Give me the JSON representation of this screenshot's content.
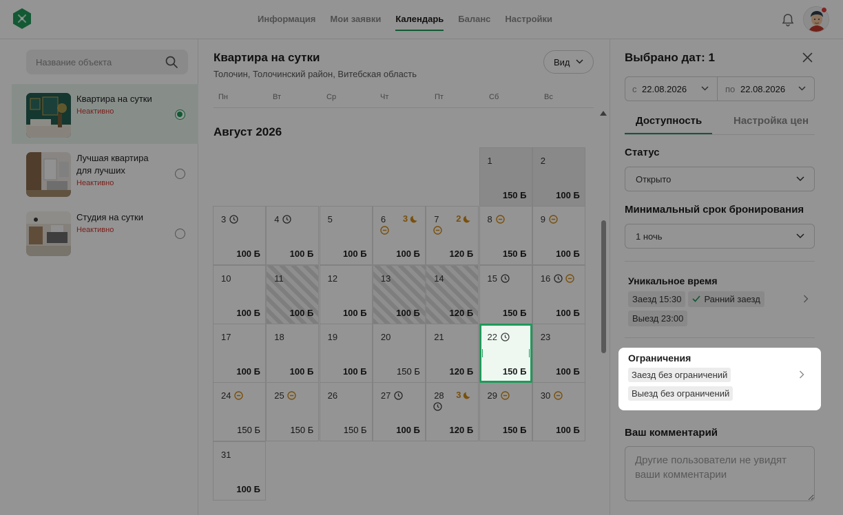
{
  "nav": {
    "items": [
      "Информация",
      "Мои заявки",
      "Календарь",
      "Баланс",
      "Настройки"
    ],
    "active": "Календарь"
  },
  "sidebar": {
    "search_placeholder": "Название объекта",
    "properties": [
      {
        "name": "Квартира на сутки",
        "status": "Неактивно",
        "selected": true
      },
      {
        "name": "Лучшая квартира для лучших",
        "status": "Неактивно",
        "selected": false
      },
      {
        "name": "Студия на сутки",
        "status": "Неактивно",
        "selected": false
      }
    ]
  },
  "main": {
    "title": "Квартира на сутки",
    "address": "Толочин, Толочинский район, Витебская область",
    "view_button": "Вид",
    "weekdays": [
      "Пн",
      "Вт",
      "Ср",
      "Чт",
      "Пт",
      "Сб",
      "Вс"
    ],
    "month": "Август 2026",
    "days": [
      {
        "d": "1",
        "price": "150 Б",
        "bold": true,
        "state": "past"
      },
      {
        "d": "2",
        "price": "100 Б",
        "bold": true,
        "state": "past"
      },
      {
        "d": "3",
        "price": "100 Б",
        "bold": true,
        "icons": [
          "clock"
        ]
      },
      {
        "d": "4",
        "price": "100 Б",
        "bold": true,
        "icons": [
          "clock"
        ]
      },
      {
        "d": "5",
        "price": "100 Б",
        "bold": true
      },
      {
        "d": "6",
        "price": "100 Б",
        "bold": true,
        "night": "3",
        "icons2": [
          "minus"
        ]
      },
      {
        "d": "7",
        "price": "120 Б",
        "bold": true,
        "night": "2",
        "icons2": [
          "minus"
        ]
      },
      {
        "d": "8",
        "price": "150 Б",
        "bold": true,
        "icons": [
          "minus"
        ]
      },
      {
        "d": "9",
        "price": "100 Б",
        "bold": true,
        "icons": [
          "minus"
        ]
      },
      {
        "d": "10",
        "price": "100 Б",
        "bold": true
      },
      {
        "d": "11",
        "price": "100 Б",
        "bold": true,
        "state": "blocked"
      },
      {
        "d": "12",
        "price": "100 Б",
        "bold": true
      },
      {
        "d": "13",
        "price": "100 Б",
        "bold": true,
        "state": "blocked"
      },
      {
        "d": "14",
        "price": "120 Б",
        "bold": true,
        "state": "blocked"
      },
      {
        "d": "15",
        "price": "150 Б",
        "bold": true,
        "icons": [
          "clock"
        ]
      },
      {
        "d": "16",
        "price": "100 Б",
        "bold": true,
        "icons": [
          "clock",
          "minus"
        ]
      },
      {
        "d": "17",
        "price": "100 Б",
        "bold": true
      },
      {
        "d": "18",
        "price": "100 Б",
        "bold": true
      },
      {
        "d": "19",
        "price": "100 Б",
        "bold": true
      },
      {
        "d": "20",
        "price": "150 Б",
        "bold": false
      },
      {
        "d": "21",
        "price": "120 Б",
        "bold": true
      },
      {
        "d": "22",
        "price": "150 Б",
        "bold": true,
        "icons": [
          "clock"
        ],
        "state": "sel"
      },
      {
        "d": "23",
        "price": "100 Б",
        "bold": true
      },
      {
        "d": "24",
        "price": "150 Б",
        "bold": false,
        "icons": [
          "minus"
        ]
      },
      {
        "d": "25",
        "price": "150 Б",
        "bold": false,
        "icons": [
          "minus"
        ]
      },
      {
        "d": "26",
        "price": "150 Б",
        "bold": false
      },
      {
        "d": "27",
        "price": "100 Б",
        "bold": true,
        "icons": [
          "clock"
        ]
      },
      {
        "d": "28",
        "price": "120 Б",
        "bold": true,
        "night": "3",
        "icons2": [
          "clock"
        ]
      },
      {
        "d": "29",
        "price": "150 Б",
        "bold": true,
        "icons": [
          "minus"
        ]
      },
      {
        "d": "30",
        "price": "100 Б",
        "bold": true,
        "icons": [
          "minus"
        ]
      },
      {
        "d": "31",
        "price": "100 Б",
        "bold": true
      }
    ]
  },
  "panel": {
    "title": "Выбрано дат: 1",
    "from_prefix": "с",
    "from_value": "22.08.2026",
    "to_prefix": "по",
    "to_value": "22.08.2026",
    "tab_availability": "Доступность",
    "tab_prices": "Настройка цен",
    "status_label": "Статус",
    "status_value": "Открыто",
    "min_label": "Минимальный срок бронирования",
    "min_value": "1 ночь",
    "unique_title": "Уникальное время",
    "checkin_chip": "Заезд 15:30",
    "early_chip": "Ранний заезд",
    "checkout_chip": "Выезд 23:00",
    "limits_title": "Ограничения",
    "limit_in": "Заезд без ограничений",
    "limit_out": "Выезд без ограничений",
    "comment_label": "Ваш комментарий",
    "comment_placeholder": "Другие пользователи не увидят ваши комментарии"
  },
  "colors": {
    "accent": "#1f9a5a",
    "inactive": "#d0382f",
    "night": "#d18a16"
  }
}
